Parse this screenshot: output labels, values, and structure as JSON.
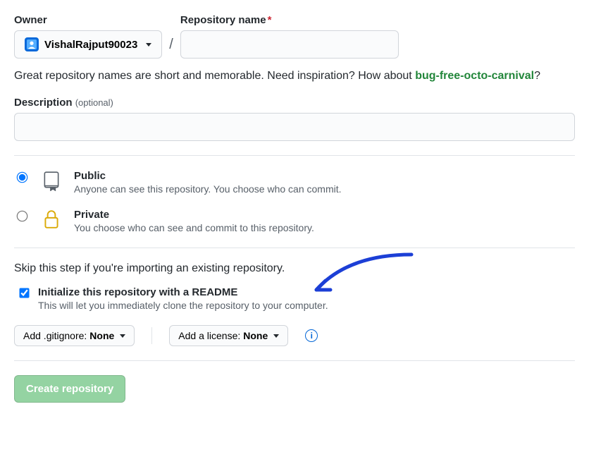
{
  "owner": {
    "label": "Owner",
    "value": "VishalRajput90023"
  },
  "repo": {
    "label": "Repository name",
    "value": ""
  },
  "hint": {
    "text": "Great repository names are short and memorable. Need inspiration? How about ",
    "suggestion": "bug-free-octo-carnival",
    "after": "?"
  },
  "description": {
    "label": "Description",
    "optional": "(optional)",
    "value": ""
  },
  "visibility": {
    "public": {
      "title": "Public",
      "desc": "Anyone can see this repository. You choose who can commit."
    },
    "private": {
      "title": "Private",
      "desc": "You choose who can see and commit to this repository."
    }
  },
  "skip_text": "Skip this step if you're importing an existing repository.",
  "initialize": {
    "title": "Initialize this repository with a README",
    "desc": "This will let you immediately clone the repository to your computer."
  },
  "gitignore": {
    "prefix": "Add .gitignore: ",
    "value": "None"
  },
  "license": {
    "prefix": "Add a license: ",
    "value": "None"
  },
  "create_btn": "Create repository"
}
